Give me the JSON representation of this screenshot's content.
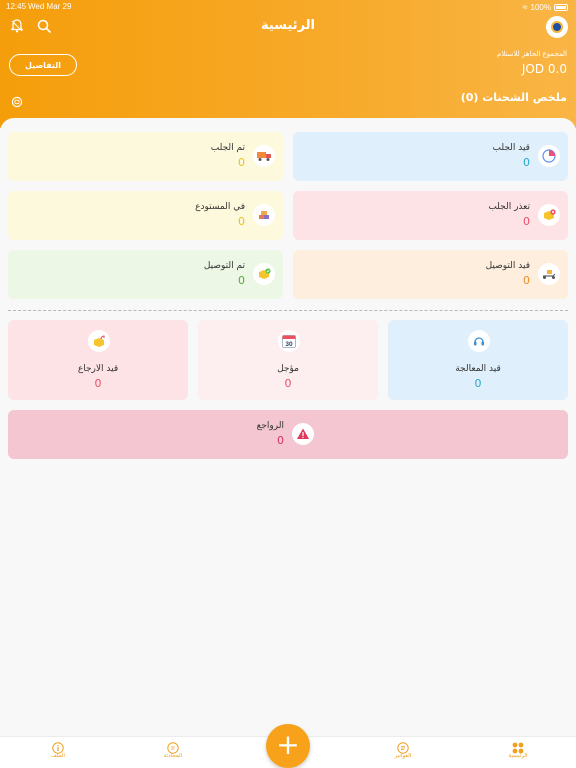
{
  "status_bar": {
    "time": "12:45",
    "date": "Wed Mar 29",
    "battery": "100%"
  },
  "header": {
    "title": "الرئيسية",
    "details_button": "التفاصيل",
    "ready_label": "المجموع الجاهز للاستلام",
    "ready_amount": "JOD 0.0",
    "summary_title": "ملخص الشحنات (0)"
  },
  "cards": {
    "pickup_pending": {
      "label": "قيد الجلب",
      "value": "0"
    },
    "picked_up": {
      "label": "تم الجلب",
      "value": "0"
    },
    "pickup_failed": {
      "label": "تعذر الجلب",
      "value": "0"
    },
    "in_warehouse": {
      "label": "في المستودع",
      "value": "0"
    },
    "in_delivery": {
      "label": "قيد التوصيل",
      "value": "0"
    },
    "delivered": {
      "label": "تم التوصيل",
      "value": "0"
    },
    "processing": {
      "label": "قيد المعالجة",
      "value": "0"
    },
    "postponed": {
      "label": "مؤجل",
      "value": "0",
      "calendar_day": "30"
    },
    "returning": {
      "label": "قيد الارجاع",
      "value": "0"
    },
    "returns": {
      "label": "الرواجع",
      "value": "0"
    }
  },
  "tabs": {
    "home": "الرئيسية",
    "invoices": "الفواتير",
    "chat": "المحادثة",
    "profile": "الملف"
  },
  "colors": {
    "accent": "#f7a21a",
    "blue_card": "#dff0fc",
    "yellow_card": "#fdf9dc",
    "red_card": "#fde3e6",
    "green_card": "#edf7e6",
    "orange_card": "#fdeedd",
    "returns_card": "#f3c6d1"
  }
}
